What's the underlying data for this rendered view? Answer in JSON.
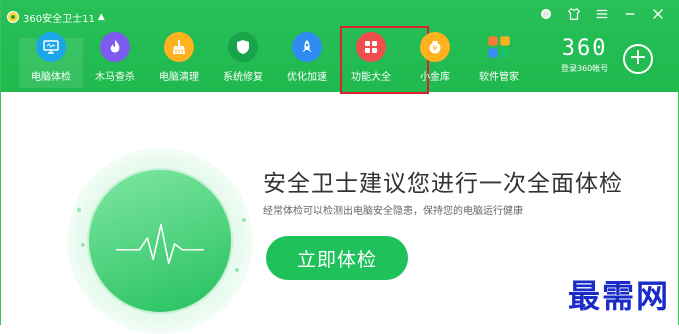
{
  "app": {
    "title": "360安全卫士11"
  },
  "window_controls": [
    "medal",
    "shirt",
    "menu",
    "minimize",
    "close"
  ],
  "nav": {
    "items": [
      {
        "label": "电脑体检",
        "icon": "monitor-check-icon",
        "color": "#1aa6e8",
        "active": true
      },
      {
        "label": "木马查杀",
        "icon": "flame-icon",
        "color": "#7e5bef"
      },
      {
        "label": "电脑清理",
        "icon": "broom-icon",
        "color": "#ffb21f"
      },
      {
        "label": "系统修复",
        "icon": "shield-icon",
        "color": "#19a34a"
      },
      {
        "label": "优化加速",
        "icon": "rocket-icon",
        "color": "#2f8cf2"
      },
      {
        "label": "功能大全",
        "icon": "grid-icon",
        "color": "#f04d4d"
      },
      {
        "label": "小金库",
        "icon": "coin-icon",
        "color": "#ffb21f"
      },
      {
        "label": "软件管家",
        "icon": "apps-icon",
        "color": "#ff7a38"
      }
    ]
  },
  "brand": {
    "logo_text": "360",
    "login_text": "登录360帐号"
  },
  "main": {
    "headline": "安全卫士建议您进行一次全面体检",
    "subtext": "经常体检可以检测出电脑安全隐患，保持您的电脑运行健康",
    "scan_button": "立即体检"
  },
  "watermark": "最需网"
}
